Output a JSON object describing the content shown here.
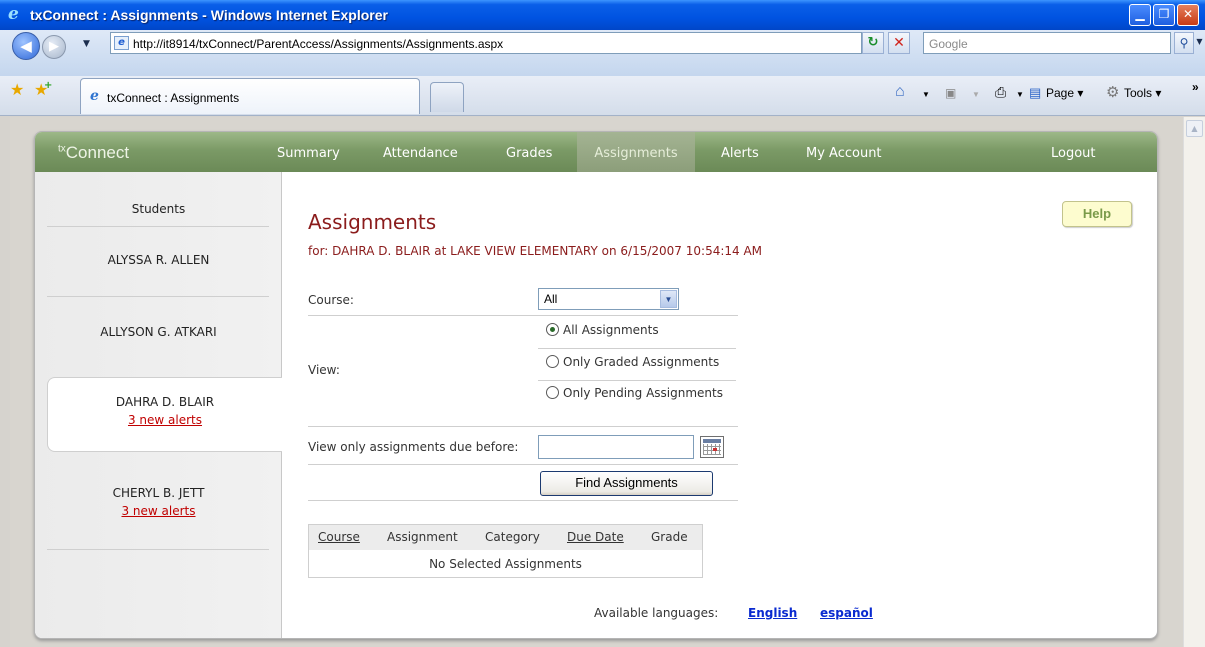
{
  "window": {
    "title": "txConnect : Assignments - Windows Internet Explorer",
    "min_glyph": "▁",
    "max_glyph": "❐",
    "close_glyph": "✕"
  },
  "addressbar": {
    "url": "http://it8914/txConnect/ParentAccess/Assignments/Assignments.aspx",
    "search_placeholder": "Google",
    "back_glyph": "◀",
    "forward_glyph": "▶",
    "refresh_glyph": "↻",
    "stop_glyph": "✕",
    "search_glyph": "⚲"
  },
  "tabs": {
    "active_label": "txConnect : Assignments"
  },
  "commandbar": {
    "page_label": "Page ▾",
    "tools_label": "Tools ▾",
    "more_glyph": "»"
  },
  "app": {
    "logo_prefix": "tx",
    "logo_text": "Connect",
    "nav": {
      "summary": "Summary",
      "attendance": "Attendance",
      "grades": "Grades",
      "assignments": "Assignments",
      "alerts": "Alerts",
      "my_account": "My Account",
      "logout": "Logout"
    },
    "sidebar": {
      "heading": "Students",
      "students": [
        {
          "name": "ALYSSA R. ALLEN",
          "alerts": ""
        },
        {
          "name": "ALLYSON G. ATKARI",
          "alerts": ""
        },
        {
          "name": "DAHRA D. BLAIR",
          "alerts": "3 new alerts"
        },
        {
          "name": "CHERYL B. JETT",
          "alerts": "3 new alerts"
        }
      ]
    },
    "main": {
      "help_label": "Help",
      "title": "Assignments",
      "subtitle": "for: DAHRA D. BLAIR at LAKE VIEW ELEMENTARY on 6/15/2007 10:54:14 AM",
      "course_label": "Course:",
      "course_value": "All",
      "view_label": "View:",
      "view_options": [
        "All Assignments",
        "Only Graded Assignments",
        "Only Pending Assignments"
      ],
      "view_selected": "All Assignments",
      "due_before_label": "View only assignments due before:",
      "due_before_value": "",
      "find_button": "Find Assignments",
      "table_headers": {
        "course": "Course",
        "assignment": "Assignment",
        "category": "Category",
        "due_date": "Due Date",
        "grade": "Grade"
      },
      "empty_message": "No Selected Assignments",
      "languages_label": "Available languages:",
      "languages": [
        "English",
        "español"
      ]
    }
  },
  "colors": {
    "header_green": "#7b9a66",
    "title_red": "#8b1c1c",
    "alert_red": "#c00000",
    "link_blue": "#0a2ad0",
    "ie_blue": "#0053e1"
  }
}
